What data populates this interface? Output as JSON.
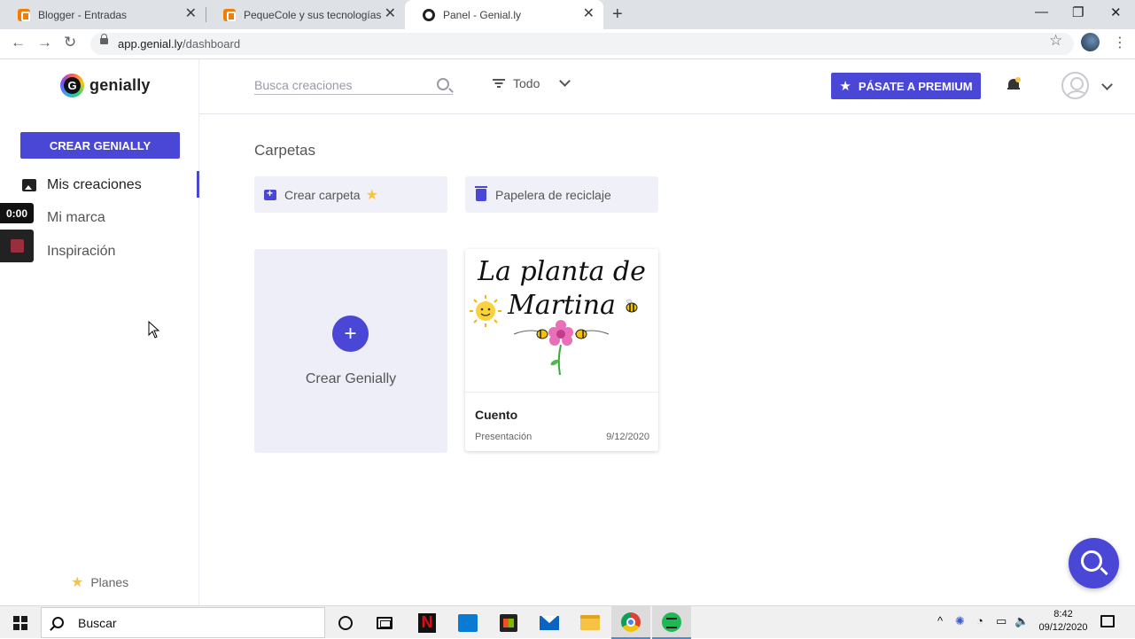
{
  "browser": {
    "tabs": [
      {
        "title": "Blogger - Entradas",
        "active": false
      },
      {
        "title": "PequeCole y sus tecnologías",
        "active": false
      },
      {
        "title": "Panel - Genial.ly",
        "active": true
      }
    ],
    "url_host": "app.genial.ly",
    "url_path": "/dashboard"
  },
  "sidebar": {
    "logo_text": "genially",
    "logo_letter": "G",
    "create_button": "CREAR GENIALLY",
    "nav": [
      {
        "label": "Mis creaciones",
        "icon": "image-icon",
        "active": true
      },
      {
        "label": "Mi marca",
        "icon": "brand-icon",
        "active": false
      },
      {
        "label": "Inspiración",
        "icon": "inspiration-icon",
        "active": false
      }
    ],
    "plans_label": "Planes"
  },
  "recorder": {
    "time": "0:00"
  },
  "topbar": {
    "search_placeholder": "Busca creaciones",
    "filter_label": "Todo",
    "premium_button": "PÁSATE A PREMIUM"
  },
  "main": {
    "folders_title": "Carpetas",
    "create_folder_label": "Crear carpeta",
    "recycle_bin_label": "Papelera de reciclaje",
    "create_card_label": "Crear Genially",
    "creations": [
      {
        "name": "Cuento",
        "type": "Presentación",
        "date": "9/12/2020",
        "thumb_title_line1": "La planta de",
        "thumb_title_line2": "Martina"
      }
    ]
  },
  "taskbar": {
    "search_label": "Buscar",
    "time": "8:42",
    "date": "09/12/2020"
  },
  "colors": {
    "accent": "#4b47d6",
    "star": "#f6c443",
    "card_bg": "#eeeef8"
  }
}
